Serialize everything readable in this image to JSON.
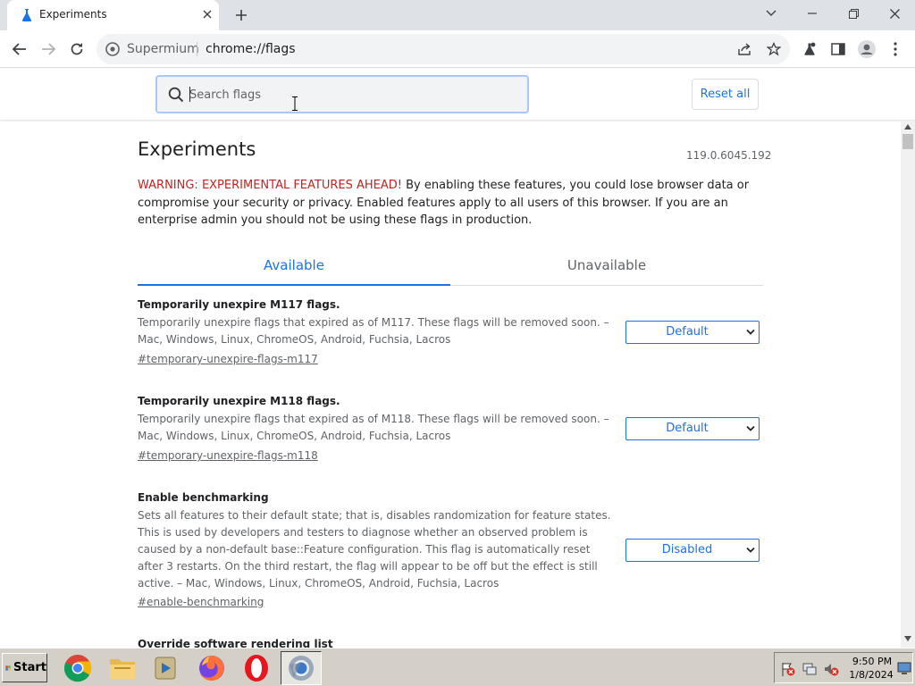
{
  "browser": {
    "tab": {
      "title": "Experiments",
      "close_icon": "close-icon"
    },
    "window_controls": {
      "dropdown": "chevron-down-icon",
      "minimize": "minimize-icon",
      "restore": "restore-icon",
      "close": "close-icon"
    },
    "omnibox": {
      "origin": "Supermium",
      "url": "chrome://flags"
    }
  },
  "search": {
    "placeholder": "Search flags",
    "value": ""
  },
  "reset_all_label": "Reset all",
  "page": {
    "title": "Experiments",
    "version": "119.0.6045.192",
    "warning_red": "WARNING: EXPERIMENTAL FEATURES AHEAD!",
    "warning_text": " By enabling these features, you could lose browser data or compromise your security or privacy. Enabled features apply to all users of this browser. If you are an enterprise admin you should not be using these flags in production."
  },
  "tabs": {
    "available": "Available",
    "unavailable": "Unavailable"
  },
  "flags": [
    {
      "title": "Temporarily unexpire M117 flags.",
      "description": "Temporarily unexpire flags that expired as of M117. These flags will be removed soon. – Mac, Windows, Linux, ChromeOS, Android, Fuchsia, Lacros",
      "link": "#temporary-unexpire-flags-m117",
      "value": "Default"
    },
    {
      "title": "Temporarily unexpire M118 flags.",
      "description": "Temporarily unexpire flags that expired as of M118. These flags will be removed soon. – Mac, Windows, Linux, ChromeOS, Android, Fuchsia, Lacros",
      "link": "#temporary-unexpire-flags-m118",
      "value": "Default"
    },
    {
      "title": "Enable benchmarking",
      "description": "Sets all features to their default state; that is, disables randomization for feature states. This is used by developers and testers to diagnose whether an observed problem is caused by a non-default base::Feature configuration. This flag is automatically reset after 3 restarts. On the third restart, the flag will appear to be off but the effect is still active. – Mac, Windows, Linux, ChromeOS, Android, Fuchsia, Lacros",
      "link": "#enable-benchmarking",
      "value": "Disabled"
    },
    {
      "title": "Override software rendering list"
    }
  ],
  "taskbar": {
    "start_label": "Start",
    "apps": [
      "chrome-icon",
      "file-explorer-icon",
      "media-player-icon",
      "firefox-icon",
      "opera-icon",
      "supermium-icon"
    ],
    "tray": {
      "time": "9:50 PM",
      "date": "1/8/2024"
    }
  },
  "colors": {
    "accent": "#1a73e8",
    "warning": "#c5221f",
    "tabstrip": "#dee1e6",
    "taskbar": "#d4d0c8"
  }
}
